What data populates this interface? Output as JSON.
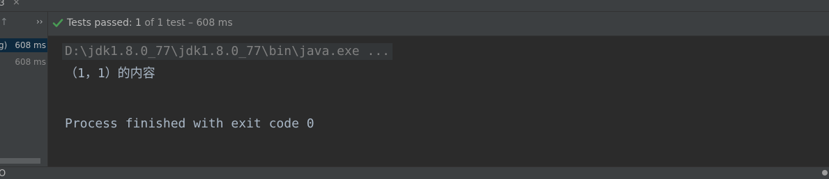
{
  "tab": {
    "label": "3",
    "close_glyph": "×"
  },
  "left_panel": {
    "up_arrow": "↑",
    "expand_glyph": "››",
    "rows": [
      {
        "name_fragment": "g)",
        "time": "608 ms",
        "selected": true
      },
      {
        "name_fragment": "",
        "time": "608 ms",
        "selected": false
      }
    ]
  },
  "status": {
    "icon": "check-icon",
    "prefix": "Tests passed: ",
    "count": "1",
    "suffix": " of 1 test – 608 ms",
    "color": "#499c54"
  },
  "console": {
    "command": "D:\\jdk1.8.0_77\\jdk1.8.0_77\\bin\\java.exe ...",
    "output": "（1，1）的内容",
    "exit": "Process finished with exit code 0"
  },
  "bottom": {
    "fragment": "O"
  }
}
